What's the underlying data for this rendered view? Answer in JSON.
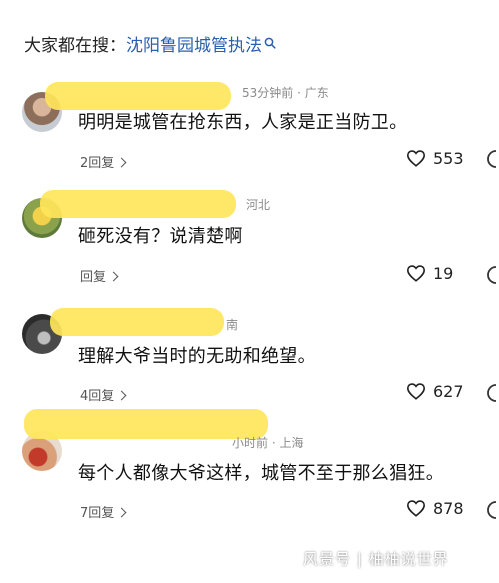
{
  "search": {
    "prefix": "大家都在搜：",
    "term": "沈阳鲁园城管执法"
  },
  "comments": [
    {
      "meta": "53分钟前 · 广东",
      "text": "明明是城管在抢东西，人家是正当防卫。",
      "replies": "2回复",
      "likes": "553"
    },
    {
      "meta": "河北",
      "text": "砸死没有？说清楚啊",
      "replies": "回复",
      "likes": "19"
    },
    {
      "meta": "南",
      "text": "理解大爷当时的无助和绝望。",
      "replies": "4回复",
      "likes": "627"
    },
    {
      "meta": "小时前 · 上海",
      "text": "每个人都像大爷这样，城管不至于那么猖狂。",
      "replies": "7回复",
      "likes": "878"
    }
  ],
  "watermark": "风景号 | 柚柚说世界",
  "colors": {
    "highlight": "#ffe55a",
    "link": "#2a5fb0",
    "meta": "#8a8a8a"
  }
}
